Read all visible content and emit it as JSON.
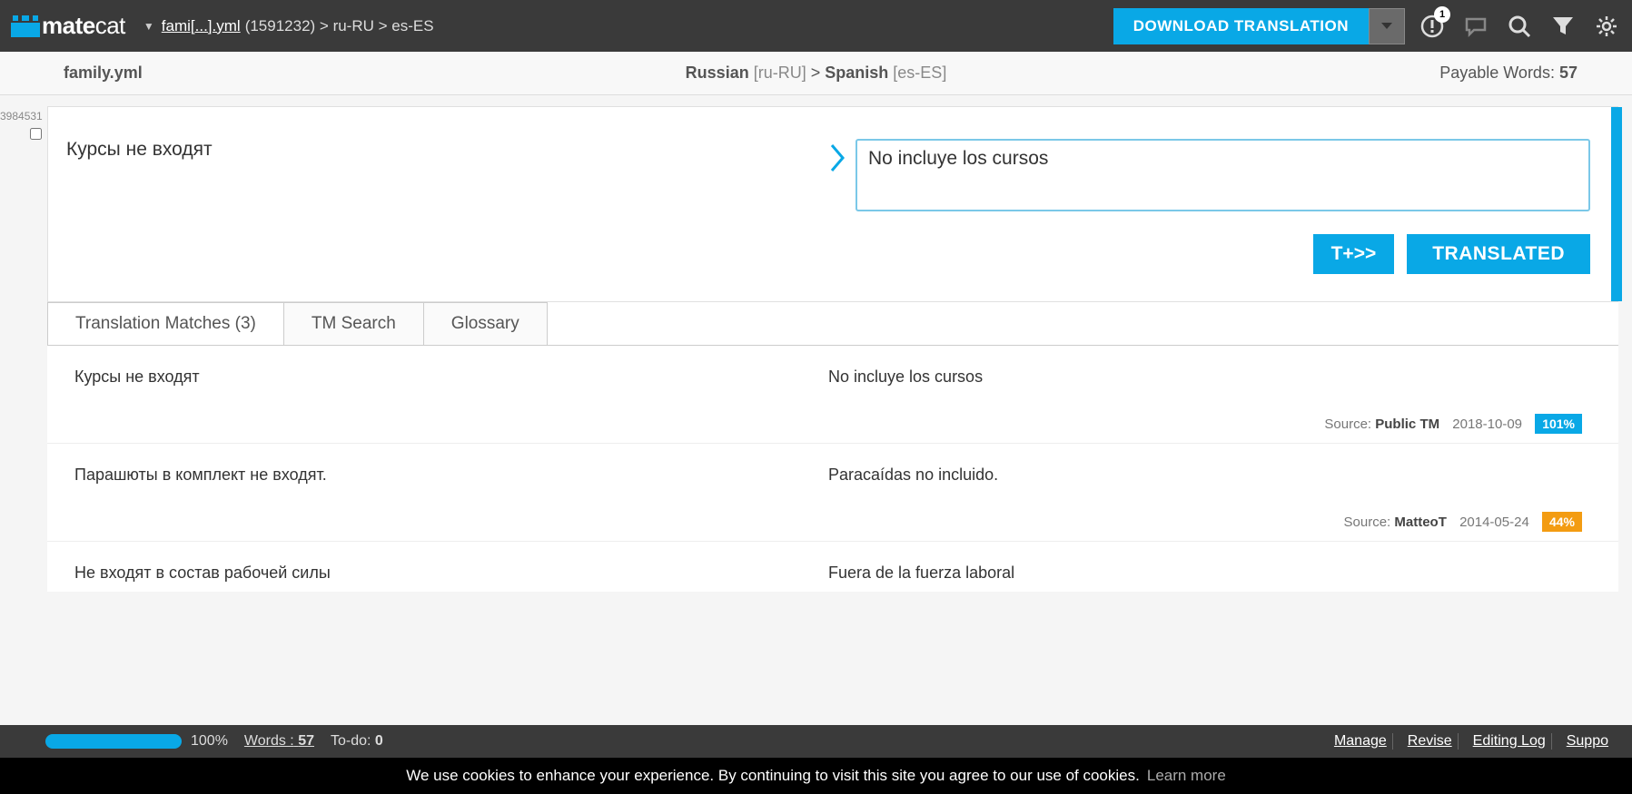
{
  "header": {
    "logo": "matecat",
    "breadcrumb_file": "fami[...].yml",
    "breadcrumb_rest": " (1591232) > ru-RU > es-ES",
    "download_label": "DOWNLOAD TRANSLATION",
    "notification_count": "1"
  },
  "subheader": {
    "filename": "family.yml",
    "source_lang": "Russian",
    "source_code": "[ru-RU]",
    "sep": ">",
    "target_lang": "Spanish",
    "target_code": "[es-ES]",
    "payable_label": "Payable Words:",
    "payable_count": "57"
  },
  "segment": {
    "id": "3984531",
    "source": "Курсы не входят",
    "target": "No incluye los cursos",
    "btn_t": "T+>>",
    "btn_translated": "TRANSLATED"
  },
  "tabs": {
    "matches_label": "Translation Matches (3)",
    "tm_search": "TM Search",
    "glossary": "Glossary"
  },
  "matches": [
    {
      "source": "Курсы не входят",
      "target": "No incluye los cursos",
      "src_label": "Source:",
      "src_name": "Public TM",
      "date": "2018-10-09",
      "pct": "101%",
      "pct_class": "pct-green"
    },
    {
      "source": "Парашюты в комплект не входят.",
      "target": "Paracaídas no incluido.",
      "src_label": "Source:",
      "src_name": "MatteoT",
      "date": "2014-05-24",
      "pct": "44%",
      "pct_class": "pct-orange"
    },
    {
      "source": "Не входят в состав рабочей силы",
      "target": "Fuera de la fuerza laboral",
      "src_label": "",
      "src_name": "",
      "date": "",
      "pct": "",
      "pct_class": ""
    }
  ],
  "footer": {
    "progress_pct": "100%",
    "words_label": "Words :",
    "words_count": "57",
    "todo_label": "To-do:",
    "todo_count": "0",
    "links": [
      "Manage",
      "Revise",
      "Editing Log",
      "Suppo"
    ]
  },
  "cookie": {
    "text": "We use cookies to enhance your experience. By continuing to visit this site you agree to our use of cookies.",
    "learn": "Learn more"
  }
}
